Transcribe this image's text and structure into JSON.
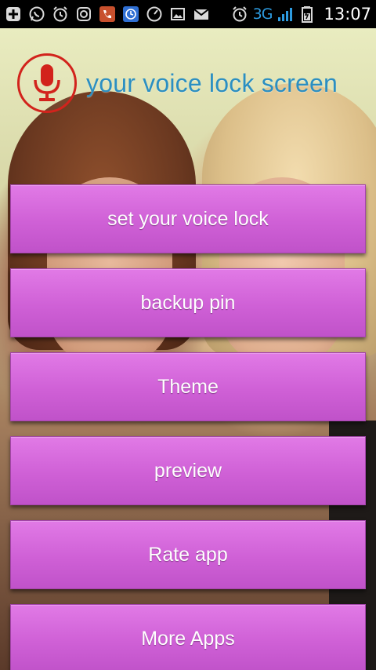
{
  "status_bar": {
    "left_icons": [
      "add-icon",
      "whatsapp-icon",
      "alarm-icon",
      "instagram-icon",
      "call-app-icon",
      "clock-app-icon",
      "speedometer-icon",
      "image-icon",
      "gmail-icon"
    ],
    "right_icons": [
      "alarm-icon",
      "signal-icon",
      "battery-icon"
    ],
    "network": "3G",
    "time": "13:07"
  },
  "header": {
    "title": "your voice lock screen",
    "logo_icon": "microphone-icon",
    "logo_color": "#d2231c",
    "title_color": "#2b8fc2"
  },
  "menu": {
    "items": [
      {
        "label": "set your voice lock"
      },
      {
        "label": "backup pin"
      },
      {
        "label": "Theme"
      },
      {
        "label": "preview"
      },
      {
        "label": "Rate app"
      },
      {
        "label": "More Apps"
      }
    ],
    "button_color": "#d467da"
  }
}
